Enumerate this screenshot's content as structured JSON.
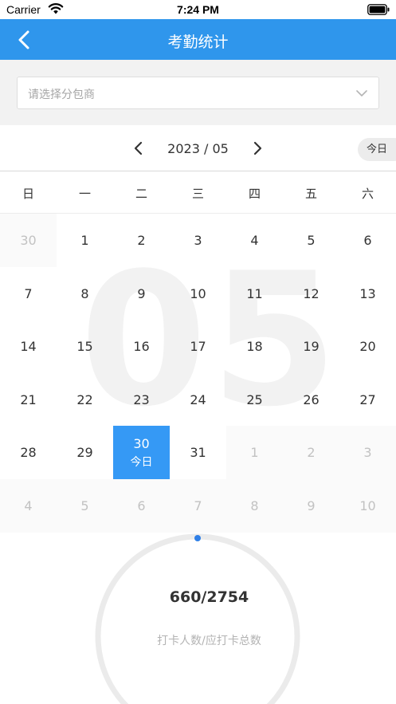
{
  "status_bar": {
    "carrier": "Carrier",
    "time": "7:24 PM"
  },
  "nav": {
    "title": "考勤统计"
  },
  "filter": {
    "placeholder": "请选择分包商"
  },
  "calendar": {
    "month_label": "2023 / 05",
    "today_label": "今日",
    "big_month": "05",
    "weekdays": [
      "日",
      "一",
      "二",
      "三",
      "四",
      "五",
      "六"
    ],
    "weeks": [
      [
        {
          "d": "30",
          "other": true
        },
        {
          "d": "1"
        },
        {
          "d": "2"
        },
        {
          "d": "3"
        },
        {
          "d": "4"
        },
        {
          "d": "5"
        },
        {
          "d": "6"
        }
      ],
      [
        {
          "d": "7"
        },
        {
          "d": "8"
        },
        {
          "d": "9"
        },
        {
          "d": "10"
        },
        {
          "d": "11"
        },
        {
          "d": "12"
        },
        {
          "d": "13"
        }
      ],
      [
        {
          "d": "14"
        },
        {
          "d": "15"
        },
        {
          "d": "16"
        },
        {
          "d": "17"
        },
        {
          "d": "18"
        },
        {
          "d": "19"
        },
        {
          "d": "20"
        }
      ],
      [
        {
          "d": "21"
        },
        {
          "d": "22"
        },
        {
          "d": "23"
        },
        {
          "d": "24"
        },
        {
          "d": "25"
        },
        {
          "d": "26"
        },
        {
          "d": "27"
        }
      ],
      [
        {
          "d": "28"
        },
        {
          "d": "29"
        },
        {
          "d": "30",
          "selected": true,
          "sub": "今日"
        },
        {
          "d": "31"
        },
        {
          "d": "1",
          "other": true
        },
        {
          "d": "2",
          "other": true
        },
        {
          "d": "3",
          "other": true
        }
      ],
      [
        {
          "d": "4",
          "other": true
        },
        {
          "d": "5",
          "other": true
        },
        {
          "d": "6",
          "other": true
        },
        {
          "d": "7",
          "other": true
        },
        {
          "d": "8",
          "other": true
        },
        {
          "d": "9",
          "other": true
        },
        {
          "d": "10",
          "other": true
        }
      ]
    ]
  },
  "attendance": {
    "ratio": "660/2754",
    "caption": "打卡人数/应打卡总数",
    "checked_in": 660,
    "total": 2754
  },
  "colors": {
    "accent": "#2f96ec",
    "selected": "#3599f5",
    "progress_dot": "#2f7fe6"
  }
}
